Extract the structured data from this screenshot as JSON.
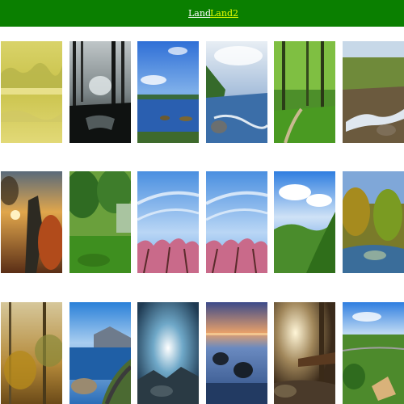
{
  "nav": {
    "links": [
      {
        "label": "Land"
      },
      {
        "label": "Land2"
      }
    ]
  },
  "colors": {
    "topbar": "#0a7f00",
    "link": "#ffffff",
    "link_active": "#eaff00"
  },
  "gallery": {
    "rows": [
      [
        {
          "icon": "misty-yellow-field"
        },
        {
          "icon": "dark-forest-pond"
        },
        {
          "icon": "blue-sky-lake"
        },
        {
          "icon": "cloudy-coast"
        },
        {
          "icon": "green-forest-path"
        },
        {
          "icon": "mountain-stream"
        }
      ],
      [
        {
          "icon": "autumn-sunset-trees"
        },
        {
          "icon": "green-park-lawn"
        },
        {
          "icon": "pink-blossoms-sky"
        },
        {
          "icon": "pink-blossoms-sky"
        },
        {
          "icon": "green-hills-sky"
        },
        {
          "icon": "autumn-trees-river"
        }
      ],
      [
        {
          "icon": "autumn-foggy-forest"
        },
        {
          "icon": "coastal-road-cliffs"
        },
        {
          "icon": "dramatic-clouds-rocks"
        },
        {
          "icon": "sunset-sea-rocks"
        },
        {
          "icon": "sunlit-forest-bridge"
        },
        {
          "icon": "countryside-aerial-view"
        }
      ]
    ]
  }
}
